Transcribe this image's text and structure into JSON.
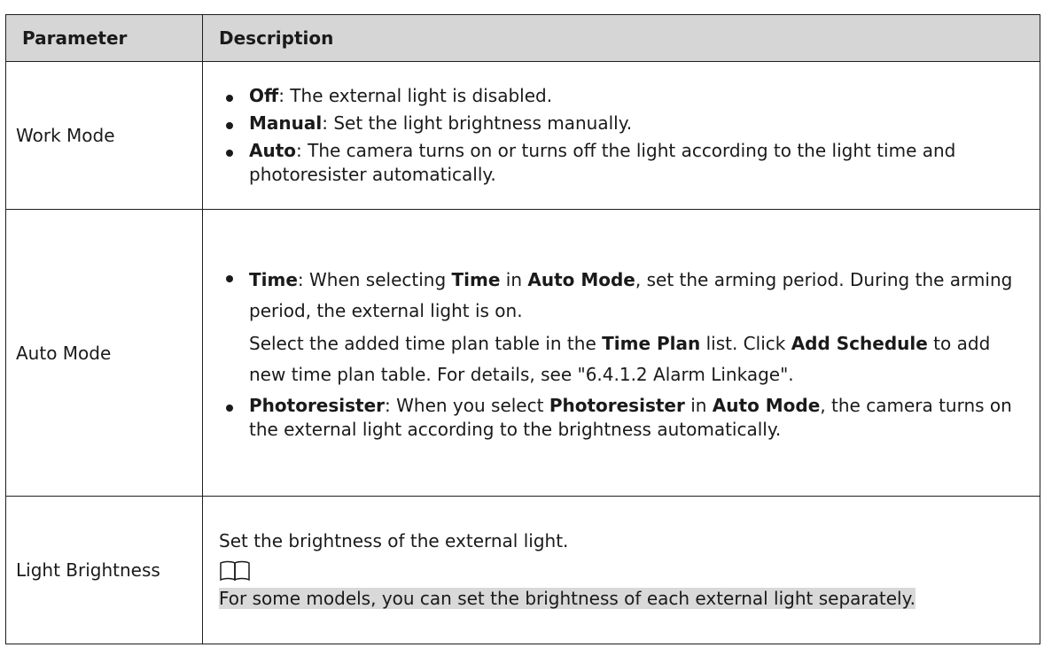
{
  "header": {
    "parameter": "Parameter",
    "description": "Description"
  },
  "rows": [
    {
      "name": "Work Mode",
      "items": [
        {
          "bold": "Off",
          "text": ": The external light is disabled."
        },
        {
          "bold": "Manual",
          "text": ": Set the light brightness manually."
        },
        {
          "bold": "Auto",
          "text": ": The camera turns on or turns off the light according to the light time and photoresister automatically."
        }
      ]
    },
    {
      "name": "Auto Mode",
      "time_item": {
        "b1": "Time",
        "t1": ": When selecting ",
        "b2": "Time",
        "t2": " in ",
        "b3": "Auto Mode",
        "t3": ", set the arming period. During the arming period, the external light is on."
      },
      "time_plan_para": {
        "t1": "Select the added time plan table in the ",
        "b1": "Time Plan",
        "t2": " list. Click ",
        "b2": "Add Schedule",
        "t3": " to add new time plan table. For details, see \"6.4.1.2 Alarm Linkage\"."
      },
      "photo_item": {
        "b1": "Photoresister",
        "t1": ": When you select ",
        "b2": "Photoresister",
        "t2": " in ",
        "b3": "Auto Mode",
        "t3": ", the camera turns on the external light according to the brightness automatically."
      }
    },
    {
      "name": "Light Brightness",
      "text": "Set the brightness of the external light.",
      "note_icon": "book-icon",
      "note": "For some models, you can set the brightness of each external light separately."
    }
  ]
}
